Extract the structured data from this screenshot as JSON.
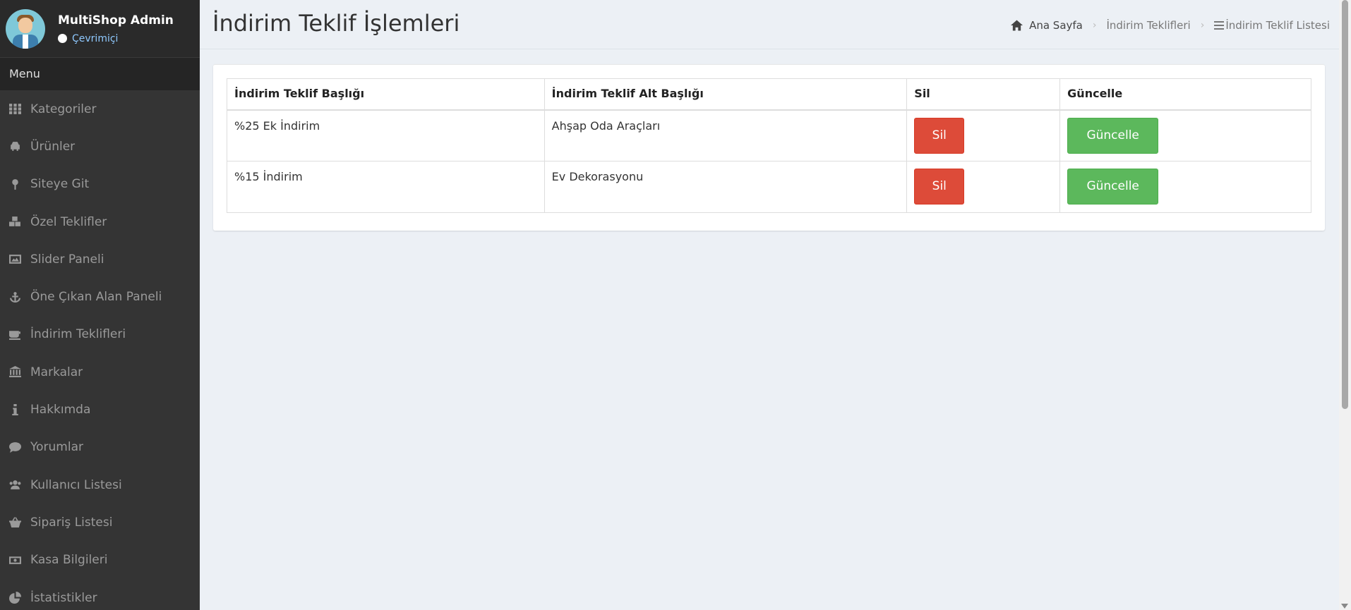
{
  "user": {
    "name": "MultiShop Admin",
    "status": "Çevrimiçi"
  },
  "sidebar": {
    "menu_header": "Menu",
    "items": [
      {
        "label": "Kategoriler",
        "icon": "grid-icon"
      },
      {
        "label": "Ürünler",
        "icon": "car-icon"
      },
      {
        "label": "Siteye Git",
        "icon": "map-pin-icon"
      },
      {
        "label": "Özel Teklifler",
        "icon": "cubes-icon"
      },
      {
        "label": "Slider Paneli",
        "icon": "image-icon"
      },
      {
        "label": "Öne Çıkan Alan Paneli",
        "icon": "anchor-icon"
      },
      {
        "label": "İndirim Teklifleri",
        "icon": "coffee-icon"
      },
      {
        "label": "Markalar",
        "icon": "bank-icon"
      },
      {
        "label": "Hakkımda",
        "icon": "info-icon"
      },
      {
        "label": "Yorumlar",
        "icon": "comment-icon"
      },
      {
        "label": "Kullanıcı Listesi",
        "icon": "users-icon"
      },
      {
        "label": "Sipariş Listesi",
        "icon": "basket-icon"
      },
      {
        "label": "Kasa Bilgileri",
        "icon": "money-icon"
      },
      {
        "label": "İstatistikler",
        "icon": "pie-chart-icon"
      }
    ]
  },
  "header": {
    "title": "İndirim Teklif İşlemleri",
    "breadcrumb": {
      "home": "Ana Sayfa",
      "section": "İndirim Teklifleri",
      "current": "İndirim Teklif Listesi"
    }
  },
  "table": {
    "columns": [
      "İndirim Teklif Başlığı",
      "İndirim Teklif Alt Başlığı",
      "Sil",
      "Güncelle"
    ],
    "rows": [
      {
        "title": "%25 Ek İndirim",
        "subtitle": "Ahşap Oda Araçları",
        "delete_label": "Sil",
        "update_label": "Güncelle"
      },
      {
        "title": "%15 İndirim",
        "subtitle": "Ev Dekorasyonu",
        "delete_label": "Sil",
        "update_label": "Güncelle"
      }
    ]
  },
  "colors": {
    "danger": "#dd4b39",
    "success": "#5cb85c",
    "sidebar": "#343434"
  }
}
